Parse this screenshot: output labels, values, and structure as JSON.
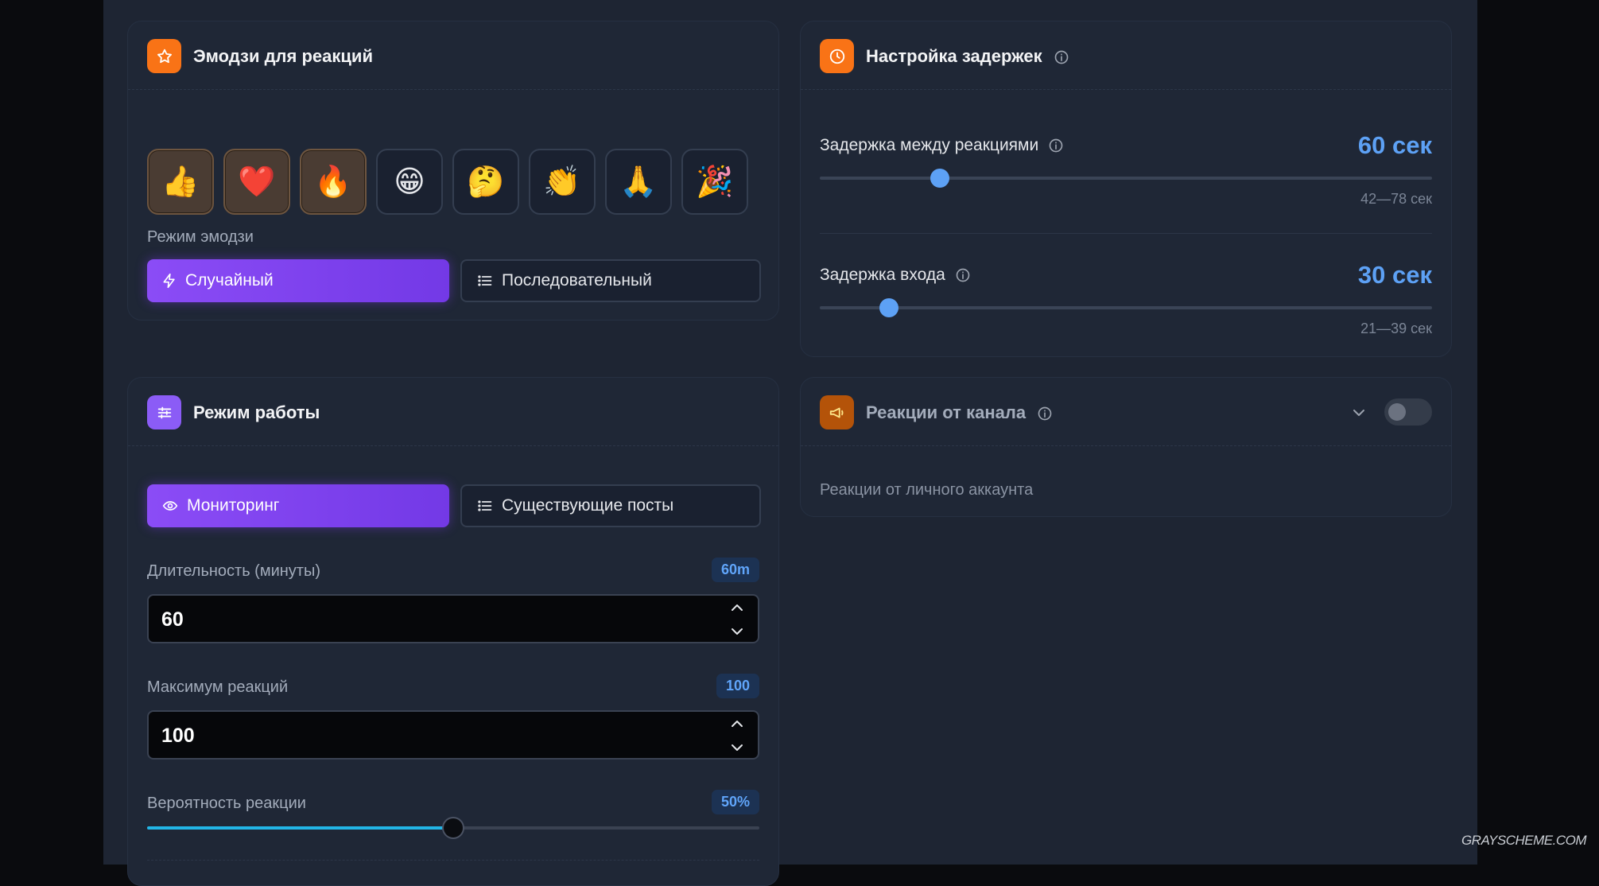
{
  "emoji_card": {
    "title": "Эмодзи для реакций",
    "icon": "star-icon",
    "accent": "#f97316",
    "emojis": [
      {
        "char": "👍",
        "active": true
      },
      {
        "char": "❤️",
        "active": true
      },
      {
        "char": "🔥",
        "active": true
      },
      {
        "char": "😁",
        "active": false
      },
      {
        "char": "🤔",
        "active": false
      },
      {
        "char": "👏",
        "active": false
      },
      {
        "char": "🙏",
        "active": false
      },
      {
        "char": "🎉",
        "active": false
      }
    ],
    "mode_label": "Режим эмодзи",
    "mode_random": "Случайный",
    "mode_sequential": "Последовательный",
    "selected_mode": "Случайный"
  },
  "work_card": {
    "title": "Режим работы",
    "icon": "sliders-icon",
    "accent": "#8b5cf6",
    "mode_monitoring": "Мониторинг",
    "mode_existing": "Существующие посты",
    "selected_mode": "Мониторинг",
    "duration_label": "Длительность (минуты)",
    "duration_badge": "60m",
    "duration_value": "60",
    "max_label": "Максимум реакций",
    "max_badge": "100",
    "max_value": "100",
    "probability_label": "Вероятность реакции",
    "probability_badge": "50%",
    "probability_value": 0.5
  },
  "delay_card": {
    "title": "Настройка задержек",
    "icon": "clock-icon",
    "accent": "#f97316",
    "between": {
      "label": "Задержка между реакциями",
      "value": "60 сек",
      "range": "42—78 сек",
      "level": 0.196
    },
    "entry": {
      "label": "Задержка входа",
      "value": "30 сек",
      "range": "21—39 сек",
      "level": 0.113
    }
  },
  "channel_card": {
    "title": "Реакции от канала",
    "icon": "megaphone-icon",
    "accent": "#b45309",
    "enabled": false,
    "subtitle": "Реакции от личного аккаунта"
  },
  "watermark": "GRAYSCHEME.COM"
}
